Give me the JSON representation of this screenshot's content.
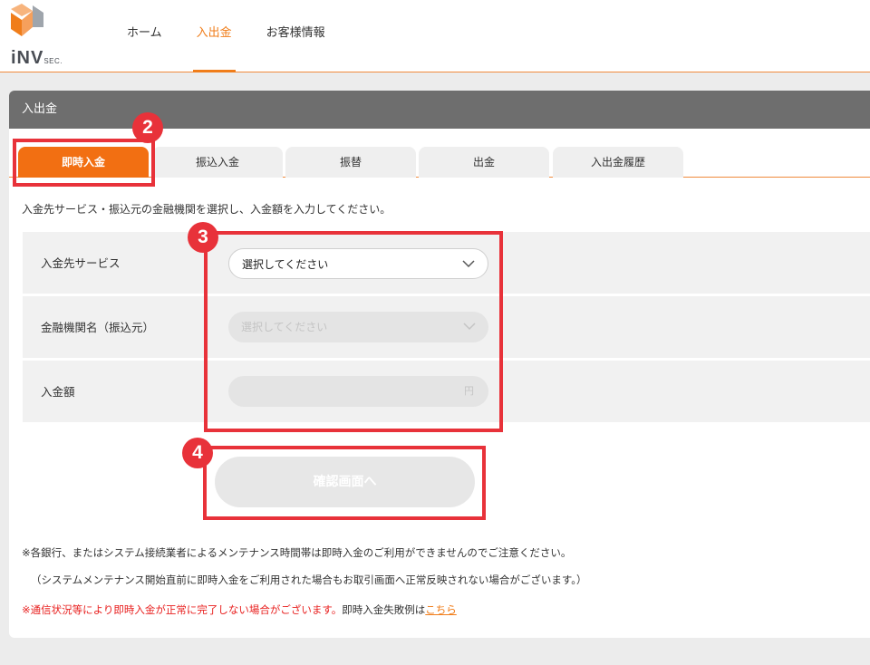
{
  "header": {
    "logo_text": "iNV",
    "logo_sub": "SEC.",
    "nav": [
      "ホーム",
      "入出金",
      "お客様情報"
    ],
    "active_nav": "入出金"
  },
  "panel": {
    "title": "入出金",
    "tabs": [
      "即時入金",
      "振込入金",
      "振替",
      "出金",
      "入出金履歴"
    ],
    "active_tab": "即時入金",
    "description": "入金先サービス・振込元の金融機関を選択し、入金額を入力してください。"
  },
  "form": {
    "service": {
      "label": "入金先サービス",
      "value": "選択してください"
    },
    "bank": {
      "label": "金融機関名（振込元）",
      "placeholder": "選択してください"
    },
    "amount": {
      "label": "入金額",
      "unit": "円"
    }
  },
  "confirm_button": "確認画面へ",
  "notes": {
    "line1": "※各銀行、またはシステム接続業者によるメンテナンス時間帯は即時入金のご利用ができませんのでご注意ください。",
    "line2": "（システムメンテナンス開始直前に即時入金をご利用された場合もお取引画面へ正常反映されない場合がございます。）",
    "line3_red": "※通信状況等により即時入金が正常に完了しない場合がございます。",
    "line3_text": "即時入金失敗例は",
    "line3_link": "こちら"
  },
  "annotations": [
    "2",
    "3",
    "4"
  ],
  "colors": {
    "accent": "#f26f12",
    "annotation": "#e8323a",
    "panel_header": "#6e6e6e"
  }
}
